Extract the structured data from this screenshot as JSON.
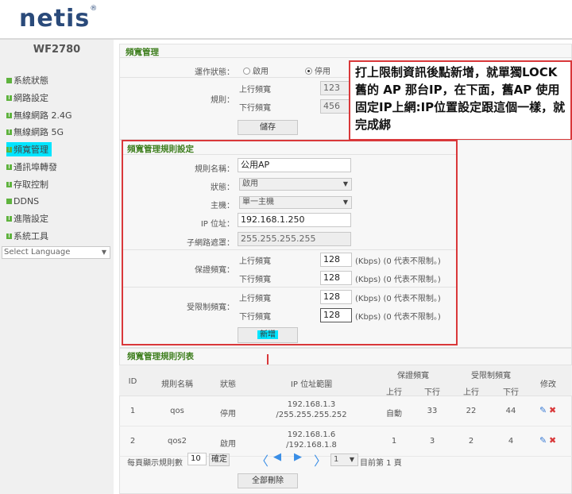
{
  "brand": {
    "logo": "netis",
    "reg": "®",
    "model": "WF2780"
  },
  "sidebar": {
    "items": [
      {
        "label": "系統狀態",
        "icon": "square-icon",
        "color": "#5fb33e"
      },
      {
        "label": "網路設定",
        "icon": "grid-icon",
        "color": "#5fb33e"
      },
      {
        "label": "無線網路 2.4G",
        "icon": "grid-icon",
        "color": "#5fb33e"
      },
      {
        "label": "無線網路 5G",
        "icon": "grid-icon",
        "color": "#5fb33e"
      },
      {
        "label": "頻寬管理",
        "icon": "grid-icon",
        "color": "#5fb33e",
        "active": true
      },
      {
        "label": "通訊埠轉發",
        "icon": "grid-icon",
        "color": "#5fb33e"
      },
      {
        "label": "存取控制",
        "icon": "grid-icon",
        "color": "#5fb33e"
      },
      {
        "label": "DDNS",
        "icon": "square-icon",
        "color": "#5fb33e"
      },
      {
        "label": "進階設定",
        "icon": "grid-icon",
        "color": "#5fb33e"
      },
      {
        "label": "系統工具",
        "icon": "grid-icon",
        "color": "#5fb33e"
      }
    ],
    "language": "Select Language"
  },
  "bw": {
    "title": "頻寬管理",
    "status_label": "運作狀態：",
    "enable": "啟用",
    "disable": "停用",
    "rule_label": "規則：",
    "up_label": "上行頻寬",
    "up_value": "123",
    "down_label": "下行頻寬",
    "down_value": "456",
    "save": "儲存"
  },
  "rule": {
    "title": "頻寬管理規則設定",
    "name_label": "規則名稱：",
    "name_value": "公用AP",
    "state_label": "狀態：",
    "state_value": "啟用",
    "host_label": "主機：",
    "host_value": "單一主機",
    "ip_label": "IP 位址：",
    "ip_value": "192.168.1.250",
    "mask_label": "子網路遮罩：",
    "mask_value": "255.255.255.255",
    "guar_label": "保證頻寬：",
    "limit_label": "受限制頻寬：",
    "up_label": "上行頻寬",
    "down_label": "下行頻寬",
    "g_up": "128",
    "g_down": "128",
    "l_up": "128",
    "l_down": "128",
    "kbps_hint": "(Kbps) (0 代表不限制。)",
    "add": "新增"
  },
  "annotation": {
    "text": "打上限制資訊後點新增，就單獨LOCK舊的 AP 那台IP，在下面，舊AP 使用固定IP上網:IP位置設定跟這個一樣，就完成綁",
    "color": "#d9383a"
  },
  "list": {
    "title": "頻寬管理規則列表",
    "headers": {
      "id": "ID",
      "name": "規則名稱",
      "state": "狀態",
      "ip": "IP 位址範圍",
      "guar": "保證頻寬",
      "limit": "受限制頻寬",
      "edit": "修改",
      "up": "上行",
      "down": "下行"
    },
    "rows": [
      {
        "id": "1",
        "name": "qos",
        "state": "停用",
        "ip1": "192.168.1.3",
        "ip2": "/255.255.255.252",
        "g_up": "自動",
        "g_down": "33",
        "l_up": "22",
        "l_down": "44"
      },
      {
        "id": "2",
        "name": "qos2",
        "state": "啟用",
        "ip1": "192.168.1.6",
        "ip2": "/192.168.1.8",
        "g_up": "1",
        "g_down": "3",
        "l_up": "2",
        "l_down": "4"
      }
    ],
    "per_page_label": "每頁顯示規則數",
    "per_page": "10",
    "confirm": "確定",
    "page_sel": "1",
    "page_info": "目前第 1 頁",
    "delete_all": "全部刪除"
  }
}
